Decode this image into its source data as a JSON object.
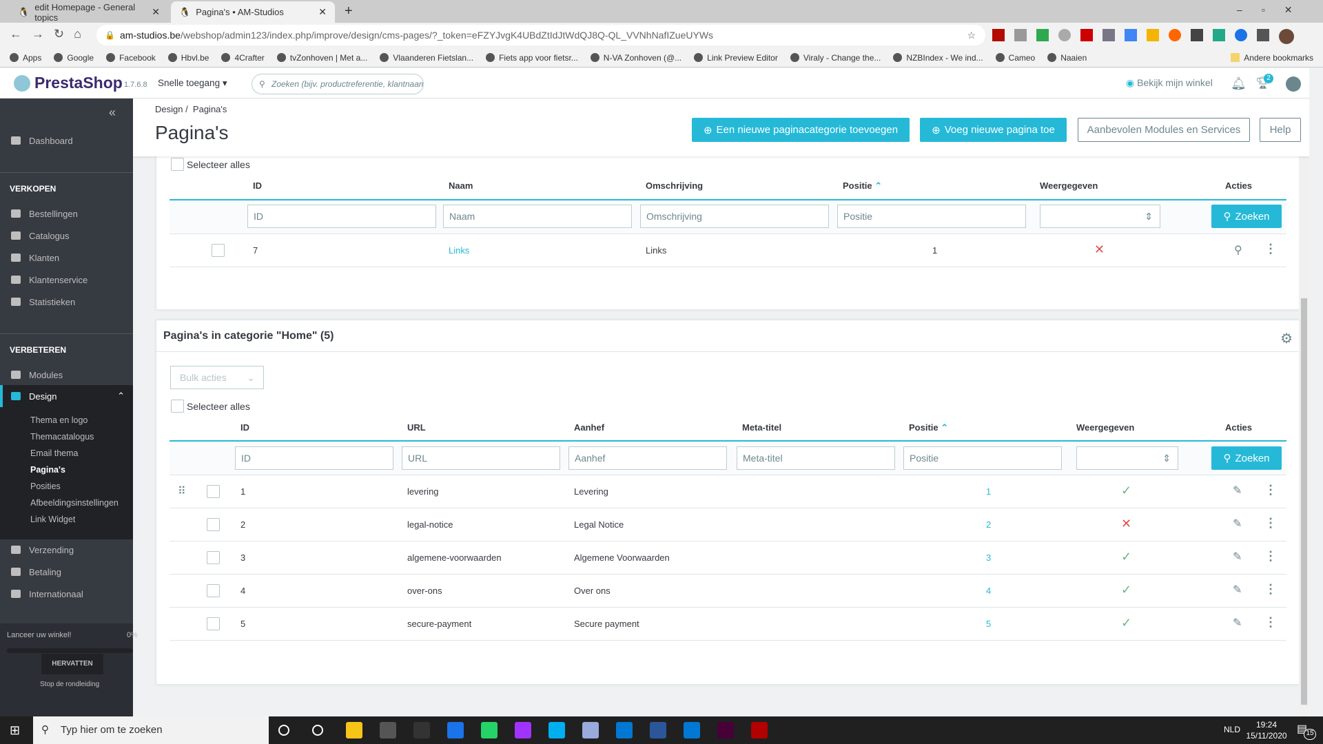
{
  "browser": {
    "tabs": [
      {
        "title": "edit Homepage - General topics"
      },
      {
        "title": "Pagina's • AM-Studios"
      }
    ],
    "url_host": "am-studios.be",
    "url_path": "/webshop/admin123/index.php/improve/design/cms-pages/?_token=eFZYJvgK4UBdZtIdJtWdQJ8Q-QL_VVNhNafIZueUYWs",
    "bookmarks": [
      "Apps",
      "Google",
      "Facebook",
      "Hbvl.be",
      "4Crafter",
      "tvZonhoven | Met a...",
      "Vlaanderen Fietslan...",
      "Fiets app voor fietsr...",
      "N-VA Zonhoven (@...",
      "Link Preview Editor",
      "Viraly - Change the...",
      "NZBIndex - We ind...",
      "Cameo",
      "Naaien"
    ],
    "other_bookmarks": "Andere bookmarks"
  },
  "header": {
    "logo": "PrestaShop",
    "version": "1.7.6.8",
    "quick_access": "Snelle toegang",
    "search_placeholder": "Zoeken (bijv. productreferentie, klantnaam...)",
    "view_shop": "Bekijk mijn winkel",
    "notification_badge": "2"
  },
  "sidebar": {
    "dashboard": "Dashboard",
    "sell_heading": "VERKOPEN",
    "sell_items": [
      "Bestellingen",
      "Catalogus",
      "Klanten",
      "Klantenservice",
      "Statistieken"
    ],
    "improve_heading": "VERBETEREN",
    "modules": "Modules",
    "design": "Design",
    "design_sub": [
      "Thema en logo",
      "Themacatalogus",
      "Email thema",
      "Pagina's",
      "Posities",
      "Afbeeldingsinstellingen",
      "Link Widget"
    ],
    "other_items": [
      "Verzending",
      "Betaling",
      "Internationaal"
    ],
    "launch": "Lanceer uw winkel!",
    "launch_percent": "0%",
    "launch_progress": 0,
    "resume": "HERVATTEN",
    "stop_tour": "Stop de rondleiding"
  },
  "page": {
    "breadcrumb": [
      "Design",
      "Pagina's"
    ],
    "title": "Pagina's",
    "btn_add_category": "Een nieuwe paginacategorie toevoegen",
    "btn_add_page": "Voeg nieuwe pagina toe",
    "btn_modules": "Aanbevolen Modules en Services",
    "btn_help": "Help"
  },
  "categories": {
    "select_all": "Selecteer alles",
    "columns": [
      "ID",
      "Naam",
      "Omschrijving",
      "Positie",
      "Weergegeven",
      "Acties"
    ],
    "filters": [
      "ID",
      "Naam",
      "Omschrijving",
      "Positie"
    ],
    "search": "Zoeken",
    "rows": [
      {
        "id": "7",
        "name": "Links",
        "description": "Links",
        "position": "1",
        "displayed": false
      }
    ]
  },
  "pages": {
    "title": "Pagina's in categorie \"Home\" (5)",
    "bulk": "Bulk acties",
    "select_all": "Selecteer alles",
    "columns": [
      "ID",
      "URL",
      "Aanhef",
      "Meta-titel",
      "Positie",
      "Weergegeven",
      "Acties"
    ],
    "filters": [
      "ID",
      "URL",
      "Aanhef",
      "Meta-titel",
      "Positie"
    ],
    "search": "Zoeken",
    "rows": [
      {
        "id": "1",
        "url": "levering",
        "title": "Levering",
        "position": "1",
        "displayed": true
      },
      {
        "id": "2",
        "url": "legal-notice",
        "title": "Legal Notice",
        "position": "2",
        "displayed": false
      },
      {
        "id": "3",
        "url": "algemene-voorwaarden",
        "title": "Algemene Voorwaarden",
        "position": "3",
        "displayed": true
      },
      {
        "id": "4",
        "url": "over-ons",
        "title": "Over ons",
        "position": "4",
        "displayed": true
      },
      {
        "id": "5",
        "url": "secure-payment",
        "title": "Secure payment",
        "position": "5",
        "displayed": true
      }
    ]
  },
  "taskbar": {
    "search": "Typ hier om te zoeken",
    "lang": "NLD",
    "time": "19:24",
    "date": "15/11/2020",
    "notifications": "15"
  },
  "colors": {
    "accent": "#25b9d7",
    "success": "#70b580",
    "danger": "#e54c4c",
    "sidebar": "#363a41"
  }
}
